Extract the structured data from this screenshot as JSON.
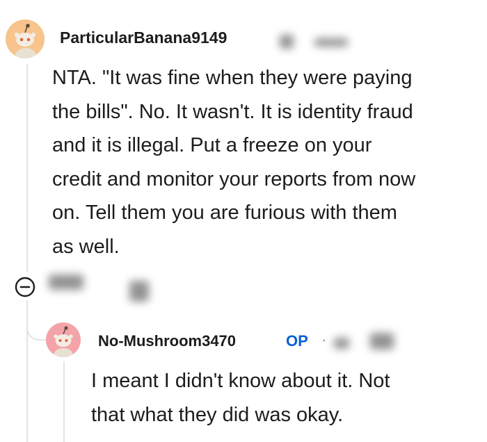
{
  "comments": [
    {
      "username": "ParticularBanana9149",
      "avatar_icon": "snoo-avatar-icon",
      "avatar_color": "#f7c48d",
      "lines": [
        "NTA. \"It was fine when they were paying",
        "the bills\". No. It wasn't. It is identity fraud",
        "and it is illegal. Put a freeze on your",
        "credit and monitor your reports from now",
        "on. Tell them you are furious with them",
        "as well."
      ]
    },
    {
      "username": "No-Mushroom3470",
      "badge": "OP",
      "separator": "·",
      "avatar_icon": "snoo-avatar-icon",
      "avatar_color": "#f4a3a8",
      "lines": [
        "I meant I didn't know about it. Not",
        "that what they did was okay."
      ]
    }
  ],
  "controls": {
    "collapse_icon": "collapse-thread-icon"
  },
  "colors": {
    "op_badge": "#0a5fd8",
    "thread_line": "#e3e3e3",
    "text": "#1c1c1c"
  }
}
